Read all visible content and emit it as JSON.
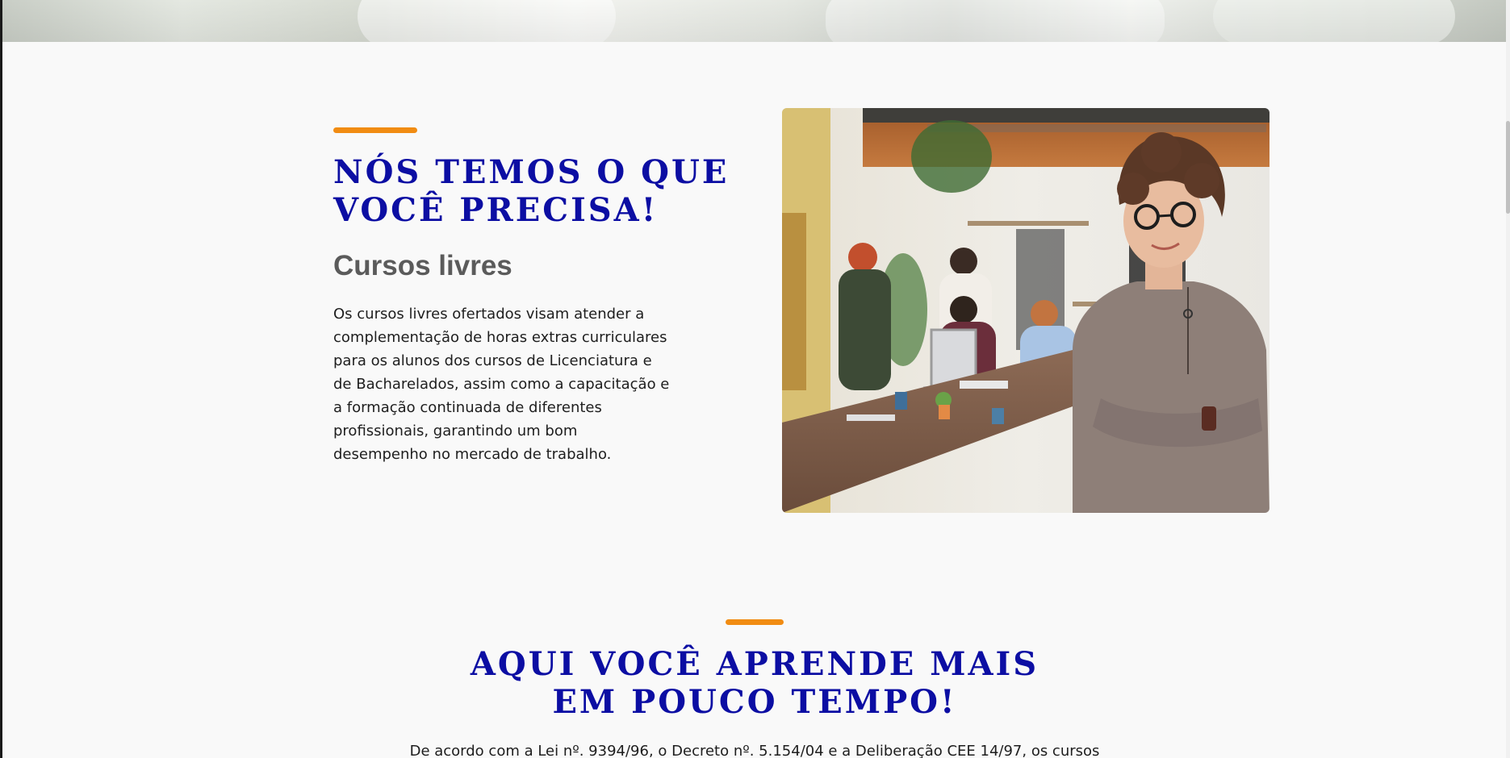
{
  "hero": {
    "image_alt": "hero-background-image"
  },
  "section_courses": {
    "title_line1": "NÓS TEMOS O QUE",
    "title_line2": "VOCÊ PRECISA!",
    "subtitle": "Cursos livres",
    "description": "Os cursos livres ofertados visam atender a complementação de horas extras curriculares para os alunos dos cursos de Licenciatura e de Bacharelados, assim como a capacitação e a formação continuada de diferentes profissionais, garantindo um bom desempenho no mercado de trabalho.",
    "image_alt": "team-meeting-photo"
  },
  "section_learn": {
    "title_line1": "AQUI VOCÊ APRENDE MAIS",
    "title_line2": "EM POUCO TEMPO!",
    "description": "De acordo com a Lei nº. 9394/96, o Decreto nº. 5.154/04 e a Deliberação CEE 14/97, os cursos"
  },
  "colors": {
    "accent": "#f18c13",
    "title": "#0c0ea3",
    "subtitle": "#5b5b5b",
    "background": "#f9f9f9"
  }
}
